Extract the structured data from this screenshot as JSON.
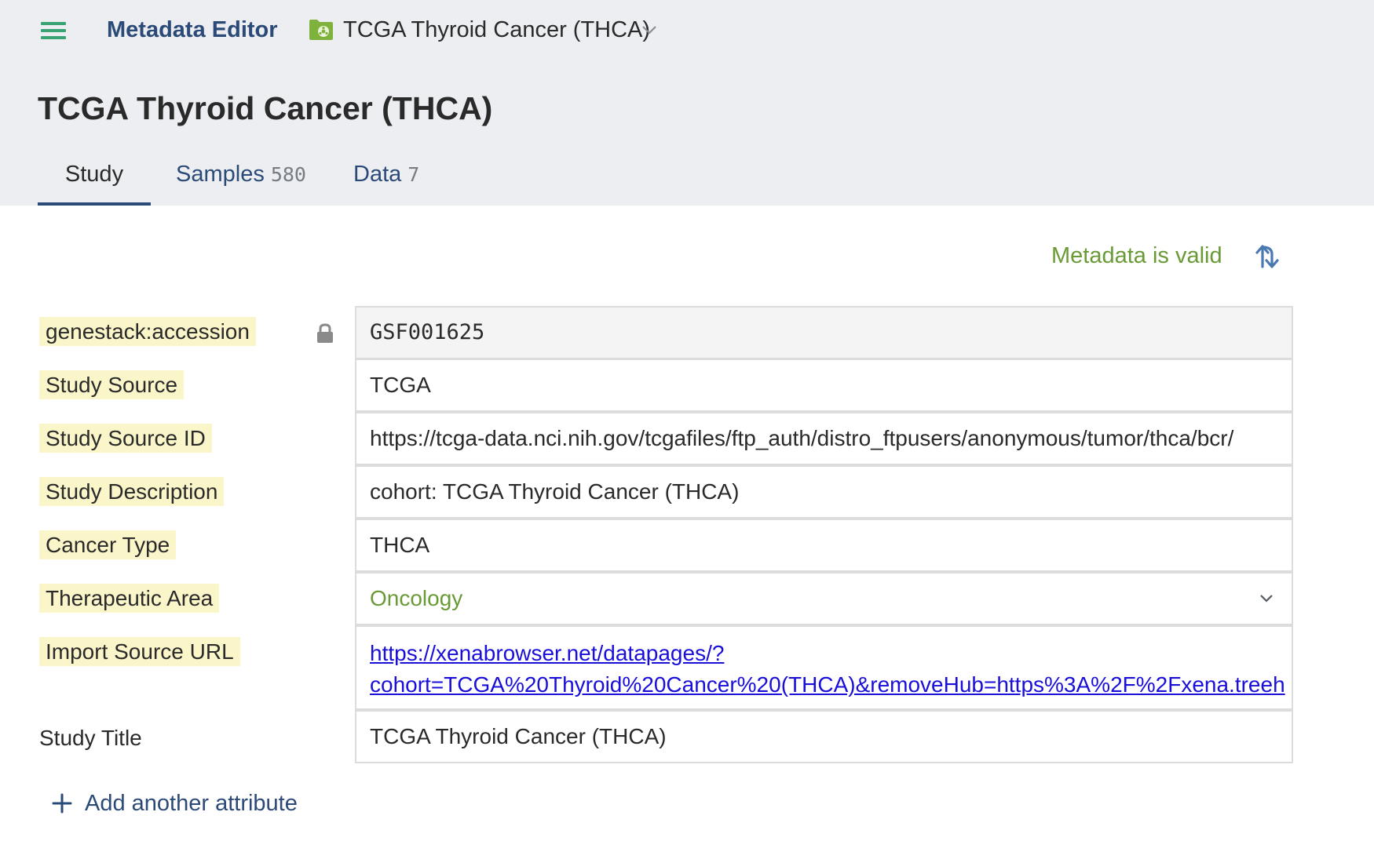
{
  "header": {
    "menu_icon": "hamburger-icon",
    "app_name": "Metadata Editor",
    "study_icon": "study-folder-icon",
    "study_switch": "TCGA Thyroid Cancer (THCA)",
    "switch_icon": "chevron-down-icon"
  },
  "page_title": "TCGA Thyroid Cancer (THCA)",
  "tabs": [
    {
      "label": "Study",
      "count": ""
    },
    {
      "label": "Samples",
      "count": "580"
    },
    {
      "label": "Data",
      "count": "7"
    }
  ],
  "status": {
    "text": "Metadata is valid",
    "sync_icon": "sync-arrows-icon"
  },
  "attributes": [
    {
      "label": "genestack:accession",
      "value": "GSF001625",
      "locked": true,
      "lock_icon": "lock-icon"
    },
    {
      "label": "Study Source",
      "value": "TCGA"
    },
    {
      "label": "Study Source ID",
      "value": "https://tcga-data.nci.nih.gov/tcgafiles/ftp_auth/distro_ftpusers/anonymous/tumor/thca/bcr/"
    },
    {
      "label": "Study Description",
      "value": "cohort: TCGA Thyroid Cancer (THCA)"
    },
    {
      "label": "Cancer Type",
      "value": "THCA"
    },
    {
      "label": "Therapeutic Area",
      "value": "Oncology",
      "type": "select"
    },
    {
      "label": "Import Source URL",
      "value_line1": "https://xenabrowser.net/datapages/?",
      "value_line2": "cohort=TCGA%20Thyroid%20Cancer%20(THCA)&removeHub=https%3A%2F%2Fxena.treeh",
      "type": "link"
    },
    {
      "label": "Study Title",
      "value": "TCGA Thyroid Cancer (THCA)"
    }
  ],
  "add_attribute": {
    "label": "Add another attribute",
    "icon": "plus-icon"
  },
  "colors": {
    "header_bg": "#eceef1",
    "brand_blue": "#2b4a78",
    "valid_green": "#6a9a36",
    "label_highlight": "#fbf6c9",
    "link_blue": "#1a0fd9",
    "menu_green": "#3aa373"
  }
}
